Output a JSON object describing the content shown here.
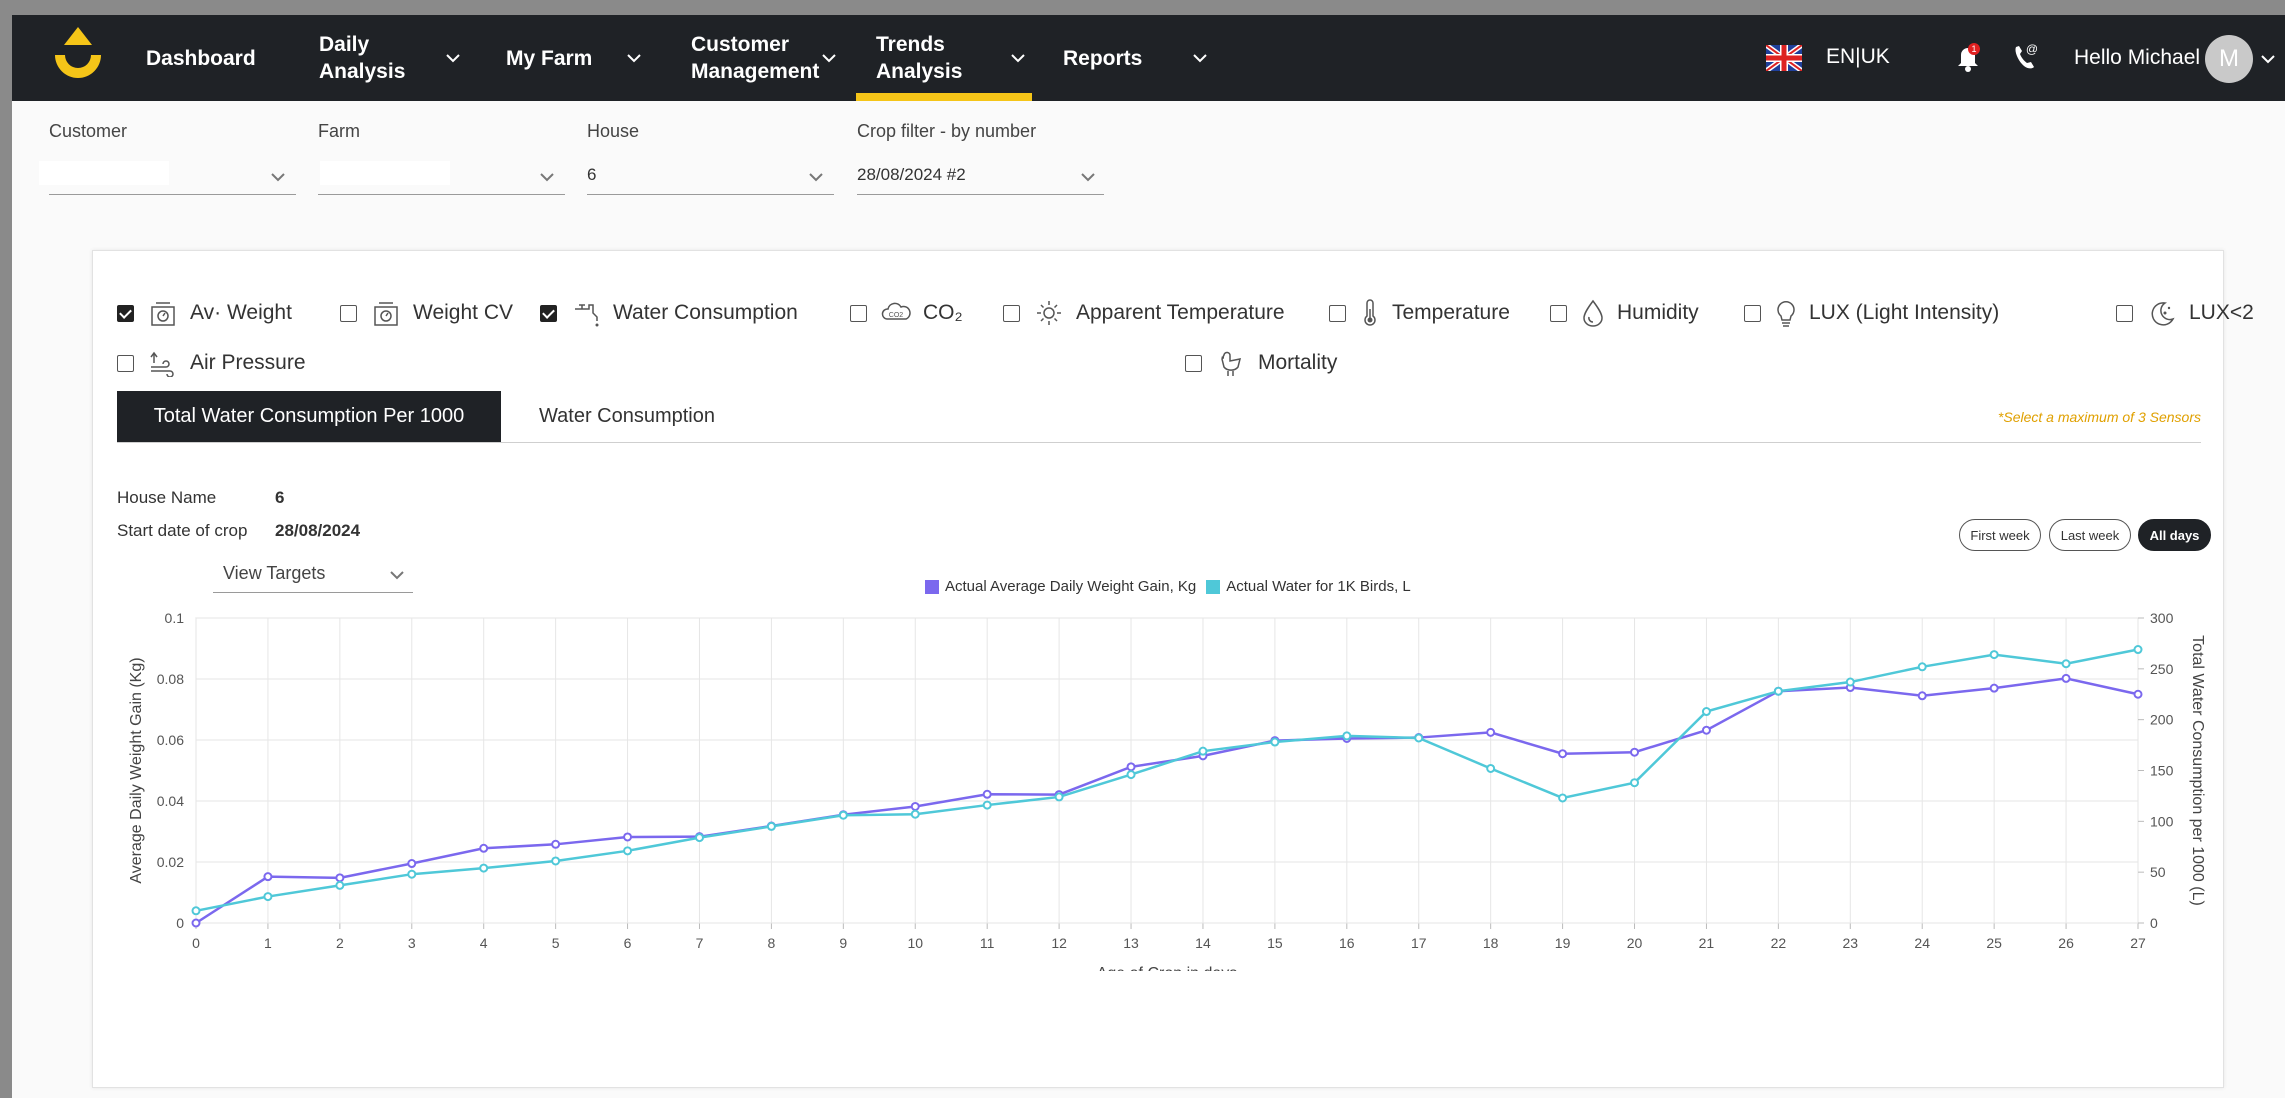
{
  "nav": {
    "items": [
      {
        "label": "Dashboard",
        "has_menu": false
      },
      {
        "label": "Daily\nAnalysis",
        "has_menu": true
      },
      {
        "label": "My Farm",
        "has_menu": true
      },
      {
        "label": "Customer\nManagement",
        "has_menu": true
      },
      {
        "label": "Trends\nAnalysis",
        "has_menu": true,
        "active": true
      },
      {
        "label": "Reports",
        "has_menu": true
      }
    ],
    "language": "EN|UK",
    "notification_count": "1",
    "greeting": "Hello Michael",
    "avatar_initial": "M",
    "accent": "#f5c518"
  },
  "filters": {
    "customer": {
      "label": "Customer",
      "value": ""
    },
    "farm": {
      "label": "Farm",
      "value": ""
    },
    "house": {
      "label": "House",
      "value": "6"
    },
    "crop": {
      "label": "Crop filter - by number",
      "value": "28/08/2024 #2"
    }
  },
  "sensors": [
    {
      "label": "Av· Weight",
      "checked": true,
      "icon": "scale-icon"
    },
    {
      "label": "Weight CV",
      "checked": false,
      "icon": "scale-icon"
    },
    {
      "label": "Water Consumption",
      "checked": true,
      "icon": "water-tap-icon"
    },
    {
      "label": "CO₂",
      "checked": false,
      "icon": "co2-cloud-icon"
    },
    {
      "label": "Apparent Temperature",
      "checked": false,
      "icon": "sun-icon"
    },
    {
      "label": "Temperature",
      "checked": false,
      "icon": "thermometer-icon"
    },
    {
      "label": "Humidity",
      "checked": false,
      "icon": "droplet-icon"
    },
    {
      "label": "LUX (Light Intensity)",
      "checked": false,
      "icon": "bulb-icon"
    },
    {
      "label": "LUX<2",
      "checked": false,
      "icon": "moon-icon"
    },
    {
      "label": "Air Pressure",
      "checked": false,
      "icon": "air-pressure-icon"
    },
    {
      "label": "Mortality",
      "checked": false,
      "icon": "chicken-icon"
    }
  ],
  "tabs": [
    {
      "label": "Total Water Consumption Per 1000",
      "active": true
    },
    {
      "label": "Water Consumption",
      "active": false
    }
  ],
  "sensor_note": "*Select a maximum of 3 Sensors",
  "house_info": {
    "house_name_label": "House Name",
    "house_name": "6",
    "start_label": "Start date of crop",
    "start_date": "28/08/2024"
  },
  "range_buttons": [
    {
      "label": "First week",
      "active": false
    },
    {
      "label": "Last week",
      "active": false
    },
    {
      "label": "All days",
      "active": true
    }
  ],
  "view_targets": "View Targets",
  "chart_data": {
    "type": "line",
    "xlabel": "Age of Crop in days",
    "ylabel": "Average Daily Weight Gain (Kg)",
    "y2label": "Total Water Consumption per 1000 (L)",
    "x": [
      0,
      1,
      2,
      3,
      4,
      5,
      6,
      7,
      8,
      9,
      10,
      11,
      12,
      13,
      14,
      15,
      16,
      17,
      18,
      19,
      20,
      21,
      22,
      23,
      24,
      25,
      26,
      27
    ],
    "ylim": [
      0,
      0.1
    ],
    "yticks": [
      "0",
      "0.02",
      "0.04",
      "0.06",
      "0.08",
      "0.1"
    ],
    "y2lim": [
      0,
      300
    ],
    "y2ticks": [
      "0",
      "50",
      "100",
      "150",
      "200",
      "250",
      "300"
    ],
    "grid": true,
    "legend_position": "top-center",
    "series": [
      {
        "name": "Actual Average Daily Weight Gain, Kg",
        "axis": "left",
        "color": "#7b68ee",
        "values": [
          0,
          0.0152,
          0.0148,
          0.0195,
          0.0245,
          0.0258,
          0.0282,
          0.0283,
          0.0318,
          0.0355,
          0.0382,
          0.0422,
          0.0421,
          0.0512,
          0.0548,
          0.0598,
          0.0605,
          0.0608,
          0.0625,
          0.0555,
          0.056,
          0.0632,
          0.076,
          0.0772,
          0.0745,
          0.077,
          0.0802,
          0.075
        ]
      },
      {
        "name": "Actual Water for 1K Birds, L",
        "axis": "right",
        "color": "#4fc8d8",
        "values": [
          12,
          26,
          37,
          48,
          54,
          61,
          71,
          84,
          95,
          106,
          107,
          116,
          124,
          146,
          169,
          178,
          184,
          182,
          152,
          123,
          138,
          208,
          228,
          237,
          252,
          264,
          255,
          269
        ]
      }
    ]
  }
}
